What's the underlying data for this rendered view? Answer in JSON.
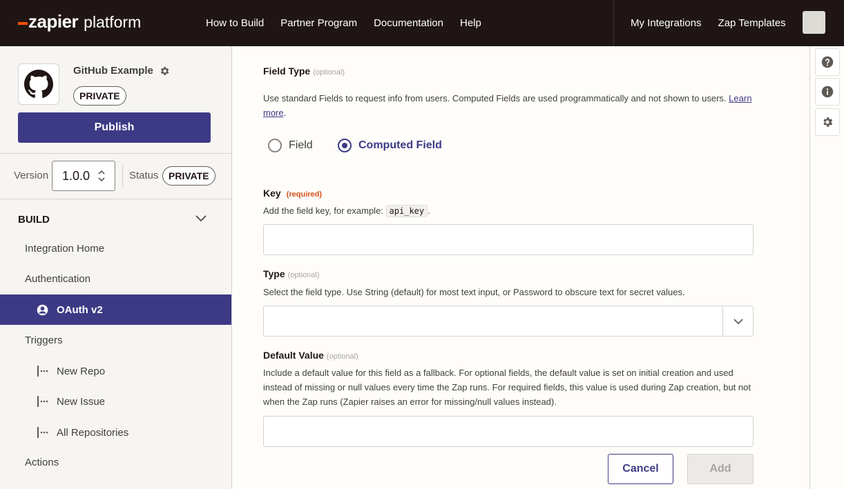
{
  "header": {
    "logo_brand": "zapier",
    "logo_sub": "platform",
    "nav_left": [
      "How to Build",
      "Partner Program",
      "Documentation",
      "Help"
    ],
    "nav_right": [
      "My Integrations",
      "Zap Templates"
    ]
  },
  "sidebar": {
    "app_name": "GitHub Example",
    "app_status": "PRIVATE",
    "publish_label": "Publish",
    "version_label": "Version",
    "version_value": "1.0.0",
    "status_label": "Status",
    "status_value": "PRIVATE",
    "build_title": "BUILD",
    "items": {
      "integration_home": "Integration Home",
      "authentication": "Authentication",
      "oauth": "OAuth v2",
      "triggers": "Triggers",
      "new_repo": "New Repo",
      "new_issue": "New Issue",
      "all_repos": "All Repositories",
      "actions": "Actions"
    }
  },
  "form": {
    "field_type": {
      "label": "Field Type",
      "tag": "(optional)",
      "help": "Use standard Fields to request info from users. Computed Fields are used programmatically and not shown to users.",
      "help_link": "Learn more",
      "options": [
        "Field",
        "Computed Field"
      ],
      "selected": "Computed Field"
    },
    "key": {
      "label": "Key",
      "tag": "(required)",
      "help_prefix": "Add the field key, for example:",
      "help_code": "api_key",
      "help_suffix": ".",
      "value": ""
    },
    "type": {
      "label": "Type",
      "tag": "(optional)",
      "help": "Select the field type. Use String (default) for most text input, or Password to obscure text for secret values.",
      "value": ""
    },
    "default_value": {
      "label": "Default Value",
      "tag": "(optional)",
      "help": "Include a default value for this field as a fallback. For optional fields, the default value is set on initial creation and used instead of missing or null values every time the Zap runs. For required fields, this value is used during Zap creation, but not when the Zap runs (Zapier raises an error for missing/null values instead).",
      "value": ""
    },
    "cancel_label": "Cancel",
    "add_label": "Add"
  },
  "rail": {
    "icons": [
      "help-icon",
      "info-icon",
      "gear-icon"
    ]
  },
  "colors": {
    "topbar": "#201515",
    "accent": "#3d3a85",
    "logo_dash": "#ff4f00",
    "required": "#d2501c"
  }
}
